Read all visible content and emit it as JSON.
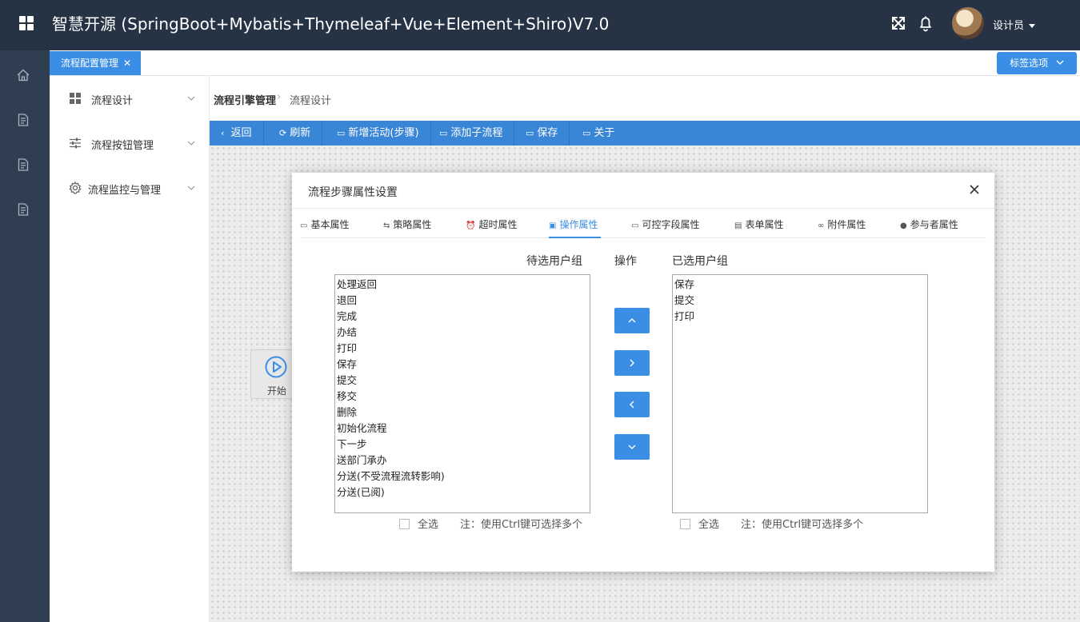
{
  "header": {
    "title": "智慧开源 (SpringBoot+Mybatis+Thymeleaf+Vue+Element+Shiro)V7.0",
    "user_name": "设计员",
    "icons": [
      "apps-grid-icon",
      "fullscreen-icon",
      "bell-icon",
      "avatar",
      "chevron-down-icon"
    ]
  },
  "rail": {
    "icons": [
      "home-icon",
      "document-icon",
      "document-icon",
      "document-icon"
    ]
  },
  "tabs": {
    "active_label": "流程配置管理",
    "close_glyph": "✕",
    "options_label": "标签选项"
  },
  "sidebar": {
    "items": [
      {
        "label": "流程设计",
        "icon": "grid-icon"
      },
      {
        "label": "流程按钮管理",
        "icon": "sliders-icon"
      },
      {
        "label": "流程监控与管理",
        "icon": "gear-icon"
      }
    ]
  },
  "breadcrumb": {
    "parent": "流程引擎管理",
    "separator": "›",
    "current": "流程设计"
  },
  "toolbar": {
    "back": "返回",
    "refresh": "刷新",
    "add_activity": "新增活动(步骤)",
    "add_subflow": "添加子流程",
    "save": "保存",
    "about": "关于"
  },
  "canvas": {
    "start_node_label": "开始"
  },
  "modal": {
    "title": "流程步骤属性设置",
    "tabs": [
      {
        "label": "基本属性",
        "icon": "monitor-icon"
      },
      {
        "label": "策略属性",
        "icon": "strategy-icon"
      },
      {
        "label": "超时属性",
        "icon": "alarm-clock-icon"
      },
      {
        "label": "操作属性",
        "icon": "operation-icon",
        "active": true
      },
      {
        "label": "可控字段属性",
        "icon": "field-icon"
      },
      {
        "label": "表单属性",
        "icon": "form-icon"
      },
      {
        "label": "附件属性",
        "icon": "paperclip-icon"
      },
      {
        "label": "参与者属性",
        "icon": "user-icon"
      }
    ],
    "available_heading": "待选用户组",
    "operation_heading": "操作",
    "selected_heading": "已选用户组",
    "available": [
      "处理返回",
      "退回",
      "完成",
      "办结",
      "打印",
      "保存",
      "提交",
      "移交",
      "删除",
      "初始化流程",
      "下一步",
      "送部门承办",
      "分送(不受流程流转影响)",
      "分送(已阅)"
    ],
    "selected": [
      "保存",
      "提交",
      "打印"
    ],
    "select_all_label": "全选",
    "note": "注：使用Ctrl键可选择多个"
  },
  "colors": {
    "header_bg": "#253345",
    "rail_bg": "#2f3e51",
    "accent": "#3a8ee6",
    "toolbar_bg": "#3a86d6"
  }
}
